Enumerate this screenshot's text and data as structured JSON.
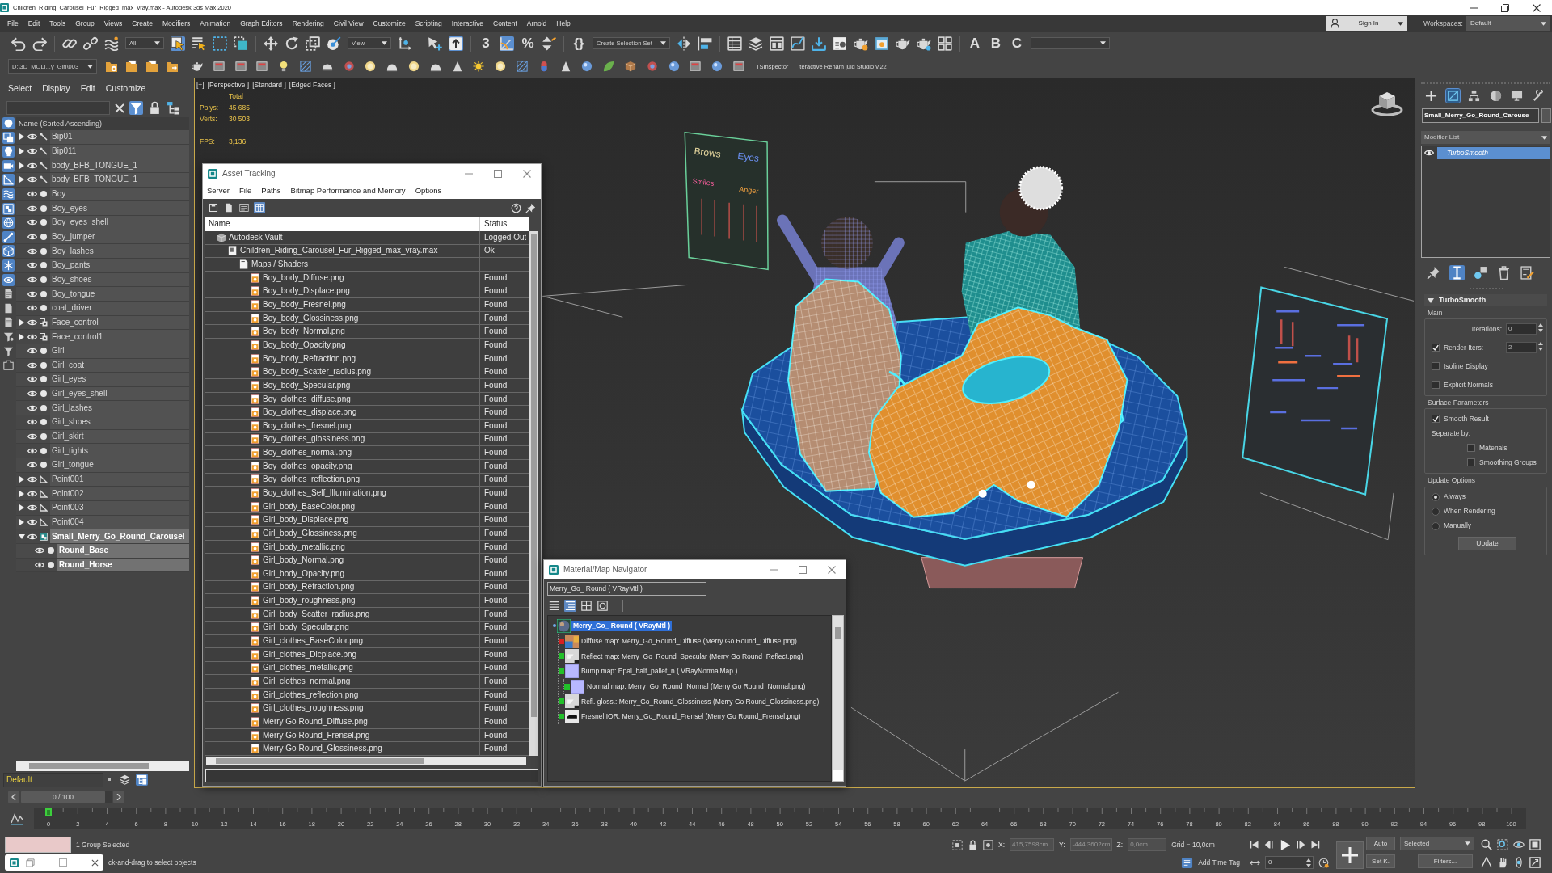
{
  "window": {
    "title": "Children_Riding_Carousel_Fur_Rigged_max_vray.max - Autodesk 3ds Max 2020"
  },
  "menu_bar": [
    "File",
    "Edit",
    "Tools",
    "Group",
    "Views",
    "Create",
    "Modifiers",
    "Animation",
    "Graph Editors",
    "Rendering",
    "Civil View",
    "Customize",
    "Scripting",
    "Interactive",
    "Content",
    "Arnold",
    "Help"
  ],
  "account": {
    "sign_in": "Sign In",
    "workspaces_label": "Workspaces:",
    "workspace": "Default"
  },
  "main_toolbar": [
    {
      "kind": "button",
      "on": false
    },
    {
      "kind": "button",
      "on": false
    },
    {
      "kind": "separator"
    },
    {
      "kind": "button",
      "on": false
    },
    {
      "kind": "button",
      "on": false
    },
    {
      "kind": "button",
      "on": false
    },
    {
      "kind": "dropdown",
      "value": "All"
    },
    {
      "kind": "button",
      "on": true
    },
    {
      "kind": "button",
      "on": false
    },
    {
      "kind": "button",
      "on": false
    },
    {
      "kind": "button",
      "on": false
    },
    {
      "kind": "separator"
    },
    {
      "kind": "button",
      "on": false
    },
    {
      "kind": "button",
      "on": false
    },
    {
      "kind": "button",
      "on": false
    },
    {
      "kind": "button",
      "on": false
    },
    {
      "kind": "dropdown",
      "value": "View"
    },
    {
      "kind": "button",
      "on": false
    },
    {
      "kind": "separator"
    },
    {
      "kind": "button",
      "on": false
    },
    {
      "kind": "button",
      "on": true
    },
    {
      "kind": "separator"
    },
    {
      "kind": "glyph",
      "label": "3",
      "on": false
    },
    {
      "kind": "button",
      "on": true
    },
    {
      "kind": "glyph",
      "label": "%",
      "on": false
    },
    {
      "kind": "button",
      "on": false
    },
    {
      "kind": "separator"
    },
    {
      "kind": "glyph",
      "label": "{}",
      "on": false
    },
    {
      "kind": "dropdown",
      "value": "Create Selection Set"
    },
    {
      "kind": "button",
      "on": false
    },
    {
      "kind": "button",
      "on": false
    },
    {
      "kind": "separator"
    },
    {
      "kind": "button",
      "on": false
    },
    {
      "kind": "button",
      "on": false
    },
    {
      "kind": "button",
      "on": false
    },
    {
      "kind": "button",
      "on": false
    },
    {
      "kind": "button",
      "on": false
    },
    {
      "kind": "button",
      "on": false
    },
    {
      "kind": "button",
      "on": false
    },
    {
      "kind": "button",
      "on": false
    },
    {
      "kind": "button",
      "on": false
    },
    {
      "kind": "button",
      "on": false
    },
    {
      "kind": "button",
      "on": false
    },
    {
      "kind": "separator"
    },
    {
      "kind": "glyph",
      "label": "A",
      "on": false
    },
    {
      "kind": "glyph",
      "label": "B",
      "on": false
    },
    {
      "kind": "glyph",
      "label": "C",
      "on": false
    },
    {
      "kind": "dropdown"
    }
  ],
  "sub_toolbar": {
    "path": "D:\\3D_MOLI...y_Girl\\003",
    "plugins": [
      "TSInspector",
      "teractive Renam juid Studio v.22"
    ]
  },
  "scene_explorer": {
    "menu": [
      "Select",
      "Display",
      "Edit",
      "Customize"
    ],
    "tools": [
      {
        "on": true
      },
      {
        "on": false
      },
      {
        "on": false
      }
    ],
    "type_filters": [
      {
        "on": true
      },
      {
        "on": true
      },
      {
        "on": true
      },
      {
        "on": true
      },
      {
        "on": true
      },
      {
        "on": true
      },
      {
        "on": true
      },
      {
        "on": true
      },
      {
        "on": true
      },
      {
        "on": true
      },
      {
        "on": true
      },
      {
        "on": true
      },
      {
        "on": false
      },
      {
        "on": false
      },
      {
        "on": false
      },
      {
        "on": false
      },
      {
        "on": false
      },
      {
        "on": false
      }
    ],
    "column": "Name (Sorted Ascending)",
    "items": [
      {
        "name": "Bip01",
        "kind": "bone",
        "expanded": false,
        "selected": false
      },
      {
        "name": "Bip011",
        "kind": "bone",
        "expanded": false,
        "selected": false
      },
      {
        "name": "body_BFB_TONGUE_1",
        "kind": "bone",
        "expanded": false,
        "selected": false
      },
      {
        "name": "body_BFB_TONGUE_1",
        "kind": "bone",
        "expanded": false,
        "selected": false
      },
      {
        "name": "Boy",
        "kind": "mesh",
        "selected": false
      },
      {
        "name": "Boy_eyes",
        "kind": "mesh",
        "selected": false
      },
      {
        "name": "Boy_eyes_shell",
        "kind": "mesh",
        "selected": false
      },
      {
        "name": "Boy_jumper",
        "kind": "mesh",
        "selected": false
      },
      {
        "name": "Boy_lashes",
        "kind": "mesh",
        "selected": false
      },
      {
        "name": "Boy_pants",
        "kind": "mesh",
        "selected": false
      },
      {
        "name": "Boy_shoes",
        "kind": "mesh",
        "selected": false
      },
      {
        "name": "Boy_tongue",
        "kind": "mesh",
        "selected": false
      },
      {
        "name": "coat_driver",
        "kind": "mesh",
        "selected": false
      },
      {
        "name": "Face_control",
        "kind": "control",
        "expanded": false,
        "selected": false
      },
      {
        "name": "Face_control1",
        "kind": "control",
        "expanded": false,
        "selected": false
      },
      {
        "name": "Girl",
        "kind": "mesh",
        "selected": false
      },
      {
        "name": "Girl_coat",
        "kind": "mesh",
        "selected": false
      },
      {
        "name": "Girl_eyes",
        "kind": "mesh",
        "selected": false
      },
      {
        "name": "Girl_eyes_shell",
        "kind": "mesh",
        "selected": false
      },
      {
        "name": "Girl_lashes",
        "kind": "mesh",
        "selected": false
      },
      {
        "name": "Girl_shoes",
        "kind": "mesh",
        "selected": false
      },
      {
        "name": "Girl_skirt",
        "kind": "mesh",
        "selected": false
      },
      {
        "name": "Girl_tights",
        "kind": "mesh",
        "selected": false
      },
      {
        "name": "Girl_tongue",
        "kind": "mesh",
        "selected": false
      },
      {
        "name": "Point001",
        "kind": "point",
        "expanded": false,
        "selected": false
      },
      {
        "name": "Point002",
        "kind": "point",
        "expanded": false,
        "selected": false
      },
      {
        "name": "Point003",
        "kind": "point",
        "expanded": false,
        "selected": false
      },
      {
        "name": "Point004",
        "kind": "point",
        "expanded": false,
        "selected": false
      },
      {
        "name": "Small_Merry_Go_Round_Carousel",
        "kind": "group",
        "expanded": true,
        "selected": true,
        "children": [
          {
            "name": "Round_Base",
            "kind": "mesh",
            "selected": true
          },
          {
            "name": "Round_Horse",
            "kind": "mesh",
            "selected": true
          }
        ]
      }
    ],
    "layer": "Default"
  },
  "viewport": {
    "active": true,
    "labels": [
      "[+]",
      "[Perspective ]",
      "[Standard ]",
      "[Edged Faces ]"
    ],
    "stats": {
      "title": "Total",
      "rows": [
        {
          "label": "Polys:",
          "value": "45 685"
        },
        {
          "label": "Verts:",
          "value": "30 503"
        }
      ],
      "fps": {
        "label": "FPS:",
        "value": "3,136"
      }
    },
    "board_labels": [
      "Brows",
      "Eyes",
      "Smiles",
      "Anger"
    ]
  },
  "command_panel": {
    "tabs": [
      {
        "selected": false
      },
      {
        "selected": true
      },
      {
        "selected": false
      },
      {
        "selected": false
      },
      {
        "selected": false
      },
      {
        "selected": false
      }
    ],
    "object_name": "Small_Merry_Go_Round_Carouse",
    "modifier_list": "Modifier List",
    "stack": [
      {
        "label": "TurboSmooth",
        "selected": true
      }
    ],
    "stack_tools": [
      {
        "on": false
      },
      {
        "on": true
      },
      {
        "on": false
      },
      {
        "on": false
      },
      {
        "on": false
      }
    ],
    "rollout": {
      "title": "TurboSmooth",
      "expanded": true,
      "groups": [
        {
          "title": "Main",
          "controls": [
            {
              "kind": "spinner",
              "label": "Iterations:",
              "value": "0"
            },
            {
              "kind": "check-spinner",
              "label": "Render Iters:",
              "checked": true,
              "value": "2"
            },
            {
              "kind": "checkbox",
              "label": "Isoline Display",
              "checked": false
            },
            {
              "kind": "checkbox",
              "label": "Explicit Normals",
              "checked": false
            }
          ]
        },
        {
          "title": "Surface Parameters",
          "controls": [
            {
              "kind": "checkbox",
              "label": "Smooth Result",
              "checked": true
            },
            {
              "kind": "label",
              "label": "Separate by:"
            },
            {
              "kind": "sub-checkbox",
              "label": "Materials",
              "checked": false
            },
            {
              "kind": "sub-checkbox",
              "label": "Smoothing Groups",
              "checked": false
            }
          ]
        },
        {
          "title": "Update Options",
          "controls": [
            {
              "kind": "radio",
              "label": "Always",
              "selected": true
            },
            {
              "kind": "radio",
              "label": "When Rendering",
              "selected": false
            },
            {
              "kind": "radio",
              "label": "Manually",
              "selected": false
            },
            {
              "kind": "button",
              "label": "Update"
            }
          ]
        }
      ]
    }
  },
  "asset_tracking": {
    "title": "Asset Tracking",
    "menu": [
      "Server",
      "File",
      "Paths",
      "Bitmap Performance and Memory",
      "Options"
    ],
    "tools_left": [
      {
        "on": false
      },
      {
        "on": false
      },
      {
        "on": false
      },
      {
        "on": true
      }
    ],
    "columns": [
      "Name",
      "Status"
    ],
    "tree": [
      {
        "name": "Autodesk Vault",
        "kind": "vault",
        "status": "Logged Out",
        "children": [
          {
            "name": "Children_Riding_Carousel_Fur_Rigged_max_vray.max",
            "kind": "max-file",
            "status": "Ok",
            "children": [
              {
                "name": "Maps / Shaders",
                "kind": "folder",
                "children": [
                  {
                    "name": "Boy_body_Diffuse.png",
                    "kind": "bitmap",
                    "status": "Found"
                  },
                  {
                    "name": "Boy_body_Displace.png",
                    "kind": "bitmap",
                    "status": "Found"
                  },
                  {
                    "name": "Boy_body_Fresnel.png",
                    "kind": "bitmap",
                    "status": "Found"
                  },
                  {
                    "name": "Boy_body_Glossiness.png",
                    "kind": "bitmap",
                    "status": "Found"
                  },
                  {
                    "name": "Boy_body_Normal.png",
                    "kind": "bitmap",
                    "status": "Found"
                  },
                  {
                    "name": "Boy_body_Opacity.png",
                    "kind": "bitmap",
                    "status": "Found"
                  },
                  {
                    "name": "Boy_body_Refraction.png",
                    "kind": "bitmap",
                    "status": "Found"
                  },
                  {
                    "name": "Boy_body_Scatter_radius.png",
                    "kind": "bitmap",
                    "status": "Found"
                  },
                  {
                    "name": "Boy_body_Specular.png",
                    "kind": "bitmap",
                    "status": "Found"
                  },
                  {
                    "name": "Boy_clothes_diffuse.png",
                    "kind": "bitmap",
                    "status": "Found"
                  },
                  {
                    "name": "Boy_clothes_displace.png",
                    "kind": "bitmap",
                    "status": "Found"
                  },
                  {
                    "name": "Boy_clothes_fresnel.png",
                    "kind": "bitmap",
                    "status": "Found"
                  },
                  {
                    "name": "Boy_clothes_glossiness.png",
                    "kind": "bitmap",
                    "status": "Found"
                  },
                  {
                    "name": "Boy_clothes_normal.png",
                    "kind": "bitmap",
                    "status": "Found"
                  },
                  {
                    "name": "Boy_clothes_opacity.png",
                    "kind": "bitmap",
                    "status": "Found"
                  },
                  {
                    "name": "Boy_clothes_reflection.png",
                    "kind": "bitmap",
                    "status": "Found"
                  },
                  {
                    "name": "Boy_clothes_Self_Illumination.png",
                    "kind": "bitmap",
                    "status": "Found"
                  },
                  {
                    "name": "Girl_body_BaseColor.png",
                    "kind": "bitmap",
                    "status": "Found"
                  },
                  {
                    "name": "Girl_body_Displace.png",
                    "kind": "bitmap",
                    "status": "Found"
                  },
                  {
                    "name": "Girl_body_Glossiness.png",
                    "kind": "bitmap",
                    "status": "Found"
                  },
                  {
                    "name": "Girl_body_metallic.png",
                    "kind": "bitmap",
                    "status": "Found"
                  },
                  {
                    "name": "Girl_body_Normal.png",
                    "kind": "bitmap",
                    "status": "Found"
                  },
                  {
                    "name": "Girl_body_Opacity.png",
                    "kind": "bitmap",
                    "status": "Found"
                  },
                  {
                    "name": "Girl_body_Refraction.png",
                    "kind": "bitmap",
                    "status": "Found"
                  },
                  {
                    "name": "Girl_body_roughness.png",
                    "kind": "bitmap",
                    "status": "Found"
                  },
                  {
                    "name": "Girl_body_Scatter_radius.png",
                    "kind": "bitmap",
                    "status": "Found"
                  },
                  {
                    "name": "Girl_body_Specular.png",
                    "kind": "bitmap",
                    "status": "Found"
                  },
                  {
                    "name": "Girl_clothes_BaseColor.png",
                    "kind": "bitmap",
                    "status": "Found"
                  },
                  {
                    "name": "Girl_clothes_Dicplace.png",
                    "kind": "bitmap",
                    "status": "Found"
                  },
                  {
                    "name": "Girl_clothes_metallic.png",
                    "kind": "bitmap",
                    "status": "Found"
                  },
                  {
                    "name": "Girl_clothes_normal.png",
                    "kind": "bitmap",
                    "status": "Found"
                  },
                  {
                    "name": "Girl_clothes_reflection.png",
                    "kind": "bitmap",
                    "status": "Found"
                  },
                  {
                    "name": "Girl_clothes_roughness.png",
                    "kind": "bitmap",
                    "status": "Found"
                  },
                  {
                    "name": "Merry Go Round_Diffuse.png",
                    "kind": "bitmap",
                    "status": "Found"
                  },
                  {
                    "name": "Merry Go Round_Frensel.png",
                    "kind": "bitmap",
                    "status": "Found"
                  },
                  {
                    "name": "Merry Go Round_Glossiness.png",
                    "kind": "bitmap",
                    "status": "Found"
                  }
                ]
              }
            ]
          }
        ]
      }
    ]
  },
  "material_navigator": {
    "title": "Material/Map Navigator",
    "field": "Merry_Go_ Round ( VRayMtl )",
    "view_modes": [
      {
        "on": false
      },
      {
        "on": true
      },
      {
        "on": false
      },
      {
        "on": false
      }
    ],
    "tree": [
      {
        "label": "Merry_Go_ Round ( VRayMtl )",
        "kind": "material",
        "selected": true,
        "children": [
          {
            "label": "Diffuse map: Merry_Go_Round_Diffuse (Merry Go Round_Diffuse.png)",
            "kind": "color-map",
            "color": "#d92020",
            "selected": false
          },
          {
            "label": "Reflect map: Merry_Go_Round_Specular (Merry Go Round_Reflect.png)",
            "kind": "mono-map",
            "color": "#22c02a",
            "selected": false
          },
          {
            "label": "Bump map: Epal_half_pallet_n ( VRayNormalMap )",
            "kind": "normal-map",
            "color": "#22c02a",
            "selected": false,
            "children": [
              {
                "label": "Normal map: Merry_Go_Round_Normal (Merry Go Round_Normal.png)",
                "kind": "normal-map",
                "color": "#22c02a",
                "selected": false
              }
            ]
          },
          {
            "label": "Refl. gloss.: Merry_Go_Round_Glossiness (Merry Go Round_Glossiness.png)",
            "kind": "mono-map",
            "color": "#22c02a",
            "selected": false
          },
          {
            "label": "Fresnel IOR: Merry_Go_Round_Frensel (Merry Go Round_Frensel.png)",
            "kind": "dark-map",
            "color": "#22c02a",
            "selected": false
          }
        ]
      }
    ]
  },
  "time_slider": {
    "label": "0 / 100",
    "level": 0
  },
  "track_bar": {
    "ticks": [
      "0",
      "2",
      "4",
      "6",
      "8",
      "10",
      "12",
      "14",
      "16",
      "18",
      "20",
      "22",
      "24",
      "26",
      "28",
      "30",
      "32",
      "34",
      "36",
      "38",
      "40",
      "42",
      "44",
      "46",
      "48",
      "50",
      "52",
      "54",
      "56",
      "58",
      "60",
      "62",
      "64",
      "66",
      "68",
      "70",
      "72",
      "74",
      "76",
      "78",
      "80",
      "82",
      "84",
      "86",
      "88",
      "90",
      "92",
      "94",
      "96",
      "98",
      "100"
    ]
  },
  "status_bar": {
    "selection": "1 Group Selected",
    "prompt": "ck-and-drag to select objects",
    "coords": [
      {
        "axis": "X:",
        "value": "415,7598cm",
        "disabled": true
      },
      {
        "axis": "Y:",
        "value": "-444,3602cm",
        "disabled": true
      },
      {
        "axis": "Z:",
        "value": "0,0cm",
        "disabled": true
      }
    ],
    "grid": "Grid = 10,0cm",
    "time_tag": "Add Time Tag",
    "frame": "0",
    "auto_key": "Auto",
    "set_key": "Set K.",
    "key_mode": "Selected",
    "filters": "Filters..."
  }
}
